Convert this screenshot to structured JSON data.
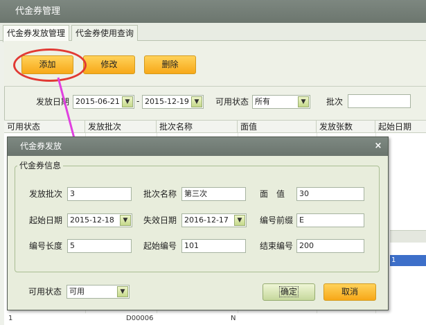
{
  "window": {
    "title": "代金券管理"
  },
  "tabs": [
    {
      "label": "代金券发放管理",
      "active": true
    },
    {
      "label": "代金券使用查询",
      "active": false
    }
  ],
  "toolbar": {
    "add_label": "添加",
    "edit_label": "修改",
    "delete_label": "删除"
  },
  "filters": {
    "issue_date_label": "发放日期",
    "date_from": "2015-06-21",
    "date_sep": "-",
    "date_to": "2015-12-19",
    "status_label": "可用状态",
    "status_value": "所有",
    "batch_label": "批次",
    "batch_value": ""
  },
  "grid": {
    "columns": [
      "可用状态",
      "发放批次",
      "批次名称",
      "面值",
      "发放张数",
      "起始日期"
    ],
    "peek_row": [
      "1",
      "D00006",
      "N"
    ],
    "right_cell": "1"
  },
  "dialog": {
    "title": "代金券发放",
    "close_symbol": "×",
    "group_title": "代金券信息",
    "fields": {
      "batch": {
        "label": "发放批次",
        "value": "3"
      },
      "batch_name": {
        "label": "批次名称",
        "value": "第三次"
      },
      "face_value": {
        "label": "面　值",
        "value": "30"
      },
      "start_date": {
        "label": "起始日期",
        "value": "2015-12-18"
      },
      "expire_date": {
        "label": "失效日期",
        "value": "2016-12-17"
      },
      "prefix": {
        "label": "编号前缀",
        "value": "E"
      },
      "code_length": {
        "label": "编号长度",
        "value": "5"
      },
      "start_no": {
        "label": "起始编号",
        "value": "101"
      },
      "end_no": {
        "label": "结束编号",
        "value": "200"
      }
    },
    "status": {
      "label": "可用状态",
      "value": "可用"
    },
    "ok_label": "确定",
    "cancel_label": "取消"
  },
  "icons": {
    "dropdown": "chevron-down-icon",
    "close": "close-icon"
  },
  "colors": {
    "annotation": "#e13a34",
    "arrow": "#e040e0",
    "orange_button": "#f7a818"
  }
}
